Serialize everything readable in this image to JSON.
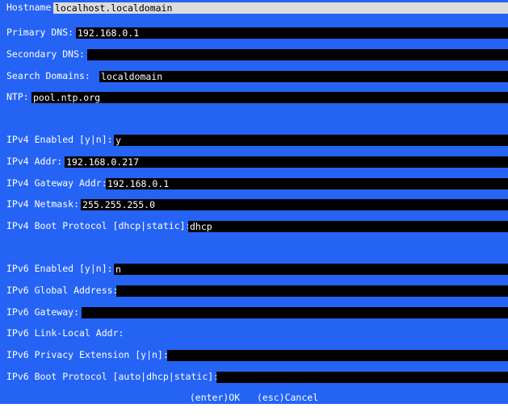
{
  "colors": {
    "background": "#2563f5",
    "field": "#000000",
    "focused_field": "#dcdcdc",
    "text": "#ffffff"
  },
  "fields": {
    "hostname": {
      "label": "Hostname: ",
      "value": "localhost.localdomain"
    },
    "primary_dns": {
      "label": "Primary DNS: ",
      "value": "192.168.0.1"
    },
    "secondary_dns": {
      "label": "Secondary DNS: ",
      "value": ""
    },
    "search_domains": {
      "label": "Search Domains: ",
      "value": "localdomain"
    },
    "ntp": {
      "label": "NTP: ",
      "value": "pool.ntp.org"
    },
    "ipv4_enabled": {
      "label": "IPv4 Enabled [y|n]: ",
      "value": "y"
    },
    "ipv4_addr": {
      "label": "IPv4 Addr: ",
      "value": "192.168.0.217"
    },
    "ipv4_gateway": {
      "label": "IPv4 Gateway Addr: ",
      "value": "192.168.0.1"
    },
    "ipv4_netmask": {
      "label": "IPv4 Netmask: ",
      "value": "255.255.255.0"
    },
    "ipv4_boot_protocol": {
      "label": "IPv4 Boot Protocol [dhcp|static]: ",
      "value": "dhcp"
    },
    "ipv6_enabled": {
      "label": "IPv6 Enabled [y|n]: ",
      "value": "n"
    },
    "ipv6_global_address": {
      "label": "IPv6 Global Address: ",
      "value": ""
    },
    "ipv6_gateway": {
      "label": "IPv6 Gateway: ",
      "value": ""
    },
    "ipv6_link_local": {
      "label": "IPv6 Link-Local Addr: ",
      "value": ""
    },
    "ipv6_privacy_extension": {
      "label": "IPv6 Privacy Extension [y|n]: ",
      "value": ""
    },
    "ipv6_boot_protocol": {
      "label": "IPv6 Boot Protocol [auto|dhcp|static]: ",
      "value": ""
    }
  },
  "footer": {
    "ok": "(enter)OK",
    "cancel": "(esc)Cancel"
  }
}
